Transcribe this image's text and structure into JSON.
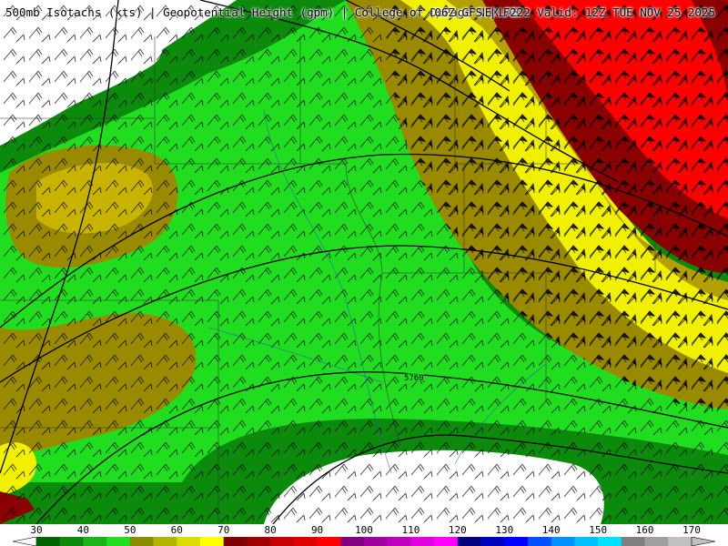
{
  "header": {
    "left_title": "500mb Isotachs (kts) | Geopotential Height (gpm) | College of DuPage NEXLAB",
    "right_title": "06Z GFS | F222 Valid: 12Z TUE NOV 25 2025"
  },
  "map": {
    "contour_label": "5760",
    "wind_speed_zones": [
      {
        "name": "calm-area-northwest",
        "range": "below 30 kts",
        "color": "#ffffff"
      },
      {
        "name": "light-green-band",
        "range": "40-60 kts",
        "color": "#20dd20"
      },
      {
        "name": "dark-green-band",
        "range": "30-40 kts",
        "color": "#0b8a0b"
      },
      {
        "name": "olive-band",
        "range": "60-70 kts",
        "color": "#9a8a00"
      },
      {
        "name": "yellow-band",
        "range": "70-80 kts",
        "color": "#f0f000"
      },
      {
        "name": "jet-core-red",
        "range": "80-100 kts",
        "color": "#ff0000"
      },
      {
        "name": "calm-area-south",
        "range": "below 30 kts",
        "color": "#ffffff"
      }
    ]
  },
  "colorbar": {
    "tick_labels": [
      "30",
      "40",
      "50",
      "60",
      "70",
      "80",
      "90",
      "100",
      "110",
      "120",
      "130",
      "140",
      "150",
      "160",
      "170"
    ],
    "segments": [
      "#006400",
      "#0b8a0b",
      "#18b418",
      "#20dd20",
      "#8c8c00",
      "#b4b400",
      "#dcdc00",
      "#ffff00",
      "#800000",
      "#a00000",
      "#c80000",
      "#e00000",
      "#ff0000",
      "#800080",
      "#a000a0",
      "#c000c0",
      "#e000e0",
      "#ff00ff",
      "#000080",
      "#0000c0",
      "#0000ff",
      "#0050ff",
      "#0090ff",
      "#00c0ff",
      "#00e0ff",
      "#808080",
      "#a0a0a0",
      "#c0c0c0"
    ]
  }
}
